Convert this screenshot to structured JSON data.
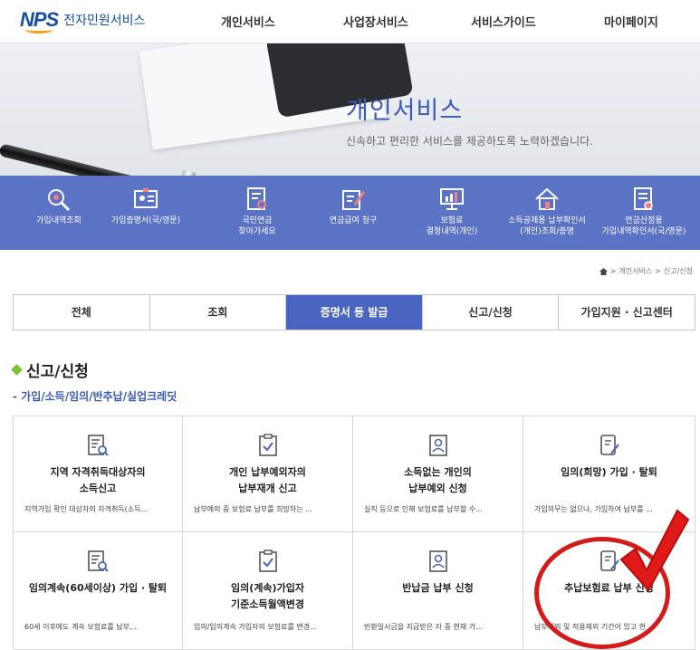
{
  "header": {
    "logo_mark": "NPS",
    "logo_text": "전자민원서비스",
    "nav": [
      "개인서비스",
      "사업장서비스",
      "서비스가이드",
      "마이페이지"
    ]
  },
  "hero": {
    "title": "개인서비스",
    "subtitle": "신속하고 편리한 서비스를 제공하도록 노력하겠습니다."
  },
  "quick_menu": [
    {
      "label": "가입내역조회",
      "icon": "search-icon"
    },
    {
      "label": "가입증명서(국/영문)",
      "icon": "id-card-icon"
    },
    {
      "label": "국민연금\n찾아가세요",
      "icon": "document-search-icon"
    },
    {
      "label": "연금급여 청구",
      "icon": "edit-document-icon"
    },
    {
      "label": "보험료\n결정내역(개인)",
      "icon": "monitor-chart-icon"
    },
    {
      "label": "소득공제용 납부확인서\n(개인)조회/증명",
      "icon": "house-icon"
    },
    {
      "label": "연금산정용\n가입내역확인서(국/영문)",
      "icon": "certificate-icon"
    }
  ],
  "breadcrumb": [
    "개인서비스",
    "신고/신청"
  ],
  "tabs": [
    {
      "label": "전체",
      "active": false
    },
    {
      "label": "조회",
      "active": false
    },
    {
      "label": "증명서 등 발급",
      "active": true
    },
    {
      "label": "신고/신청",
      "active": false
    },
    {
      "label": "가입지원 · 신고센터",
      "active": false
    }
  ],
  "section": {
    "title": "신고/신청",
    "subtitle": "- 가입/소득/임의/반추납/실업크레딧"
  },
  "cards": [
    {
      "title": "지역 자격취득대상자의\n소득신고",
      "desc": "지역가입 확인 대상자의 자격취득(소득...",
      "icon": "document-search-icon"
    },
    {
      "title": "개인 납부예외자의\n납부재개 신고",
      "desc": "납부예외 중 보험료 납부를 희망하는 ...",
      "icon": "clipboard-check-icon"
    },
    {
      "title": "소득없는 개인의\n납부예외 신청",
      "desc": "실직 등으로 인해 보험료를 납부할 수...",
      "icon": "person-card-icon"
    },
    {
      "title": "임의(희망) 가입 · 탈퇴",
      "desc": "가입의무는 없으나, 가입하여 납부를 ...",
      "icon": "tablet-pen-icon"
    },
    {
      "title": "임의계속(60세이상) 가입 · 탈퇴",
      "desc": "60세 이후에도 계속 보험료를 납부,...",
      "icon": "document-search-icon"
    },
    {
      "title": "임의(계속)가입자\n기준소득월액변경",
      "desc": "임의/임의계속 가입자의 보험료를 변경...",
      "icon": "clipboard-check-icon"
    },
    {
      "title": "반납금 납부 신청",
      "desc": "반환일시금을 지급받은 자 중 현재 가...",
      "icon": "person-card-icon"
    },
    {
      "title": "추납보험료 납부 신청",
      "desc": "납부예외 및 적용제외 기간이 있고 현",
      "icon": "tablet-pen-icon"
    }
  ],
  "colors": {
    "brand": "#3c5bb6",
    "iconbar": "#5b73c5",
    "active_tab": "#4a65bf",
    "annotation": "#d31b1b"
  }
}
